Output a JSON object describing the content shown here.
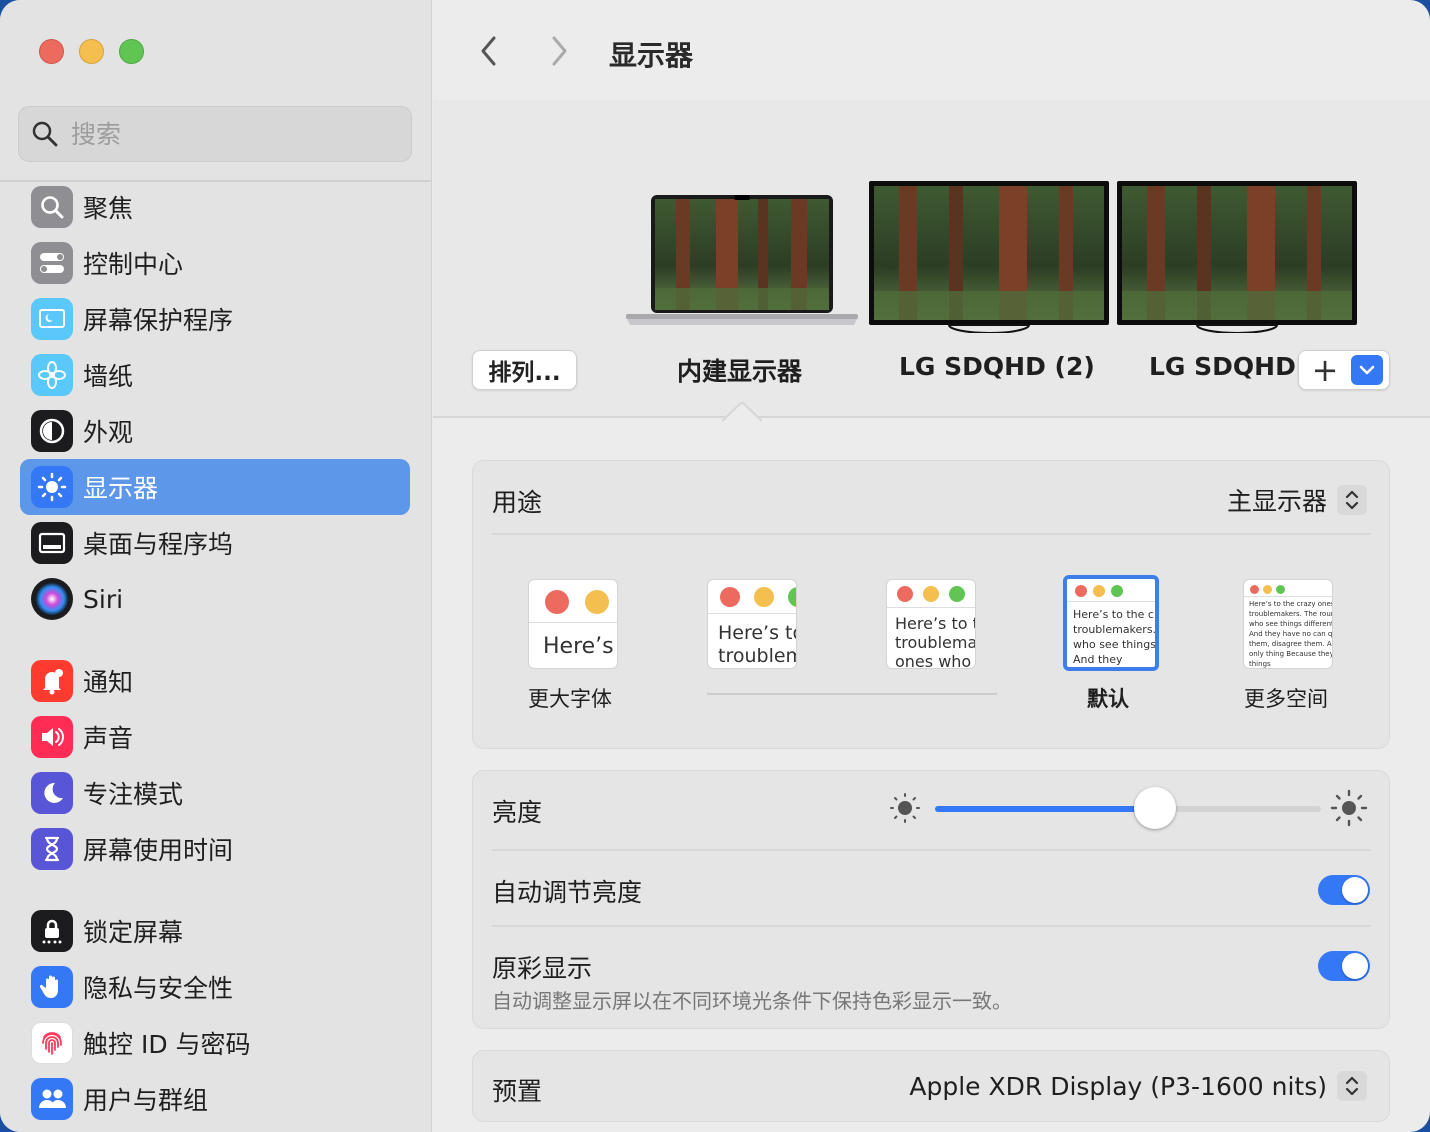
{
  "sidebar": {
    "search_placeholder": "搜索",
    "items": [
      {
        "label": "聚焦",
        "icon": "spotlight-icon",
        "color": "#8e8e93"
      },
      {
        "label": "控制中心",
        "icon": "control-center-icon",
        "color": "#8e8e93"
      },
      {
        "label": "屏幕保护程序",
        "icon": "screensaver-icon",
        "color": "#5ac8fa"
      },
      {
        "label": "墙纸",
        "icon": "wallpaper-icon",
        "color": "#5ac8fa"
      },
      {
        "label": "外观",
        "icon": "appearance-icon",
        "color": "#1c1c1e"
      },
      {
        "label": "显示器",
        "icon": "display-icon",
        "color": "#3478f6"
      },
      {
        "label": "桌面与程序坞",
        "icon": "dock-icon",
        "color": "#1c1c1e"
      },
      {
        "label": "Siri",
        "icon": "siri-icon",
        "color": "#1c1c1e"
      },
      {
        "label": "通知",
        "icon": "notifications-icon",
        "color": "#ff3b30"
      },
      {
        "label": "声音",
        "icon": "sound-icon",
        "color": "#ff2d55"
      },
      {
        "label": "专注模式",
        "icon": "focus-icon",
        "color": "#5856d6"
      },
      {
        "label": "屏幕使用时间",
        "icon": "screen-time-icon",
        "color": "#5856d6"
      },
      {
        "label": "锁定屏幕",
        "icon": "lock-screen-icon",
        "color": "#1c1c1e"
      },
      {
        "label": "隐私与安全性",
        "icon": "privacy-hand-icon",
        "color": "#3478f6"
      },
      {
        "label": "触控 ID 与密码",
        "icon": "fingerprint-icon",
        "color": "#ffffff"
      },
      {
        "label": "用户与群组",
        "icon": "users-icon",
        "color": "#3478f6"
      }
    ],
    "active_index": 5
  },
  "header": {
    "title": "显示器"
  },
  "displays": {
    "arrange_label": "排列...",
    "items": [
      {
        "label": "内建显示器",
        "selected": true
      },
      {
        "label": "LG SDQHD (2)",
        "selected": false
      },
      {
        "label": "LG SDQHD",
        "selected": false
      }
    ],
    "add_label": "+"
  },
  "usage": {
    "label": "用途",
    "value": "主显示器"
  },
  "resolution": {
    "options": [
      {
        "label": "更大字体",
        "preview": "Here’s"
      },
      {
        "label": "",
        "preview": "Here’s to troublemakers"
      },
      {
        "label": "",
        "preview": "Here’s to the troublemakers ones who"
      },
      {
        "label": "默认",
        "preview": "Here’s to the crazy troublemakers. ones who see things rules. And they"
      },
      {
        "label": "更多空间",
        "preview": "Here’s to the crazy ones troublemakers. The round ones who see things differently rules. And they have no can quote them, disagree them. About the only thing Because they change things"
      }
    ],
    "selected_index": 3
  },
  "brightness": {
    "label": "亮度",
    "value": 0.57
  },
  "auto_brightness": {
    "label": "自动调节亮度",
    "on": true
  },
  "true_tone": {
    "label": "原彩显示",
    "description": "自动调整显示屏以在不同环境光条件下保持色彩显示一致。",
    "on": true
  },
  "preset": {
    "label": "预置",
    "value": "Apple XDR Display (P3-1600 nits)"
  }
}
